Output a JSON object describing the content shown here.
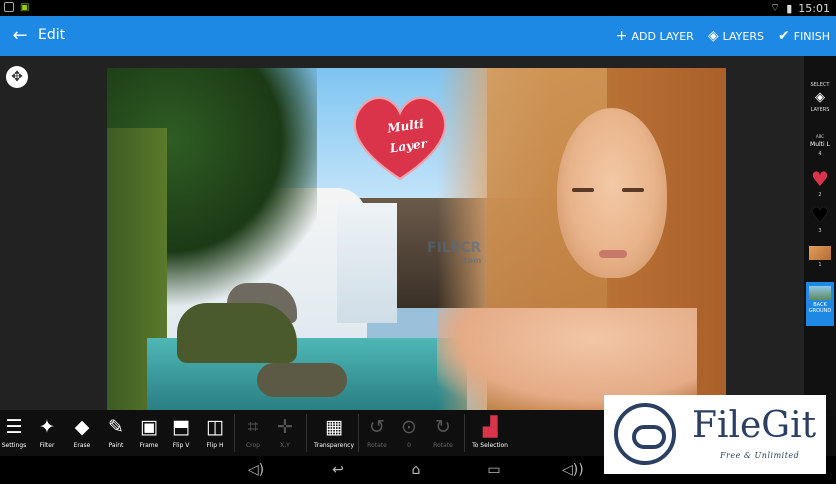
{
  "status_bar": {
    "time": "15:01"
  },
  "app_bar": {
    "title": "Edit",
    "actions": [
      {
        "label": "ADD LAYER",
        "icon": "plus-icon"
      },
      {
        "label": "LAYERS",
        "icon": "layers-icon"
      },
      {
        "label": "FINISH",
        "icon": "check-icon"
      }
    ]
  },
  "canvas": {
    "heart_text_line1": "Multi",
    "heart_text_line2": "Layer",
    "watermark": "FILECR",
    "watermark_sub": ".com"
  },
  "layers_panel": {
    "select_label_top": "SELECT",
    "select_label_bottom": "LAYERS",
    "items": [
      {
        "label": "4",
        "thumb_text": "Multi L",
        "top_text": "ABC"
      },
      {
        "label": "2",
        "thumb_icon": "red-heart-icon"
      },
      {
        "label": "3",
        "thumb_icon": "black-heart-icon"
      },
      {
        "label": "1",
        "thumb_icon": "portrait-thumbnail"
      },
      {
        "label": "BACK GROUND",
        "thumb_icon": "waterfall-thumbnail"
      }
    ]
  },
  "toolbar": {
    "tools": [
      {
        "label": "Settings",
        "icon": "sliders-icon",
        "enabled": true
      },
      {
        "label": "Filter",
        "icon": "filter-icon",
        "enabled": true
      },
      {
        "label": "Erase",
        "icon": "eraser-icon",
        "enabled": true
      },
      {
        "label": "Paint",
        "icon": "brush-icon",
        "enabled": true
      },
      {
        "label": "Frame",
        "icon": "frame-icon",
        "enabled": true
      },
      {
        "label": "Flip V",
        "icon": "flip-vertical-icon",
        "enabled": true
      },
      {
        "label": "Flip H",
        "icon": "flip-horizontal-icon",
        "enabled": true
      },
      {
        "label": "Crop",
        "icon": "crop-icon",
        "enabled": false
      },
      {
        "label": "X,Y",
        "icon": "xy-icon",
        "enabled": false
      },
      {
        "label": "Transparency",
        "icon": "transparency-icon",
        "enabled": true
      },
      {
        "label": "Rotate",
        "icon": "rotate-left-icon",
        "enabled": false
      },
      {
        "label": "0",
        "icon": "rotate-reset-icon",
        "enabled": false
      },
      {
        "label": "Rotate",
        "icon": "rotate-right-icon",
        "enabled": false
      },
      {
        "label": "To Selection",
        "icon": "to-selection-icon",
        "enabled": true
      }
    ]
  },
  "badge": {
    "name": "FileGit",
    "tagline": "Free & Unlimited"
  }
}
